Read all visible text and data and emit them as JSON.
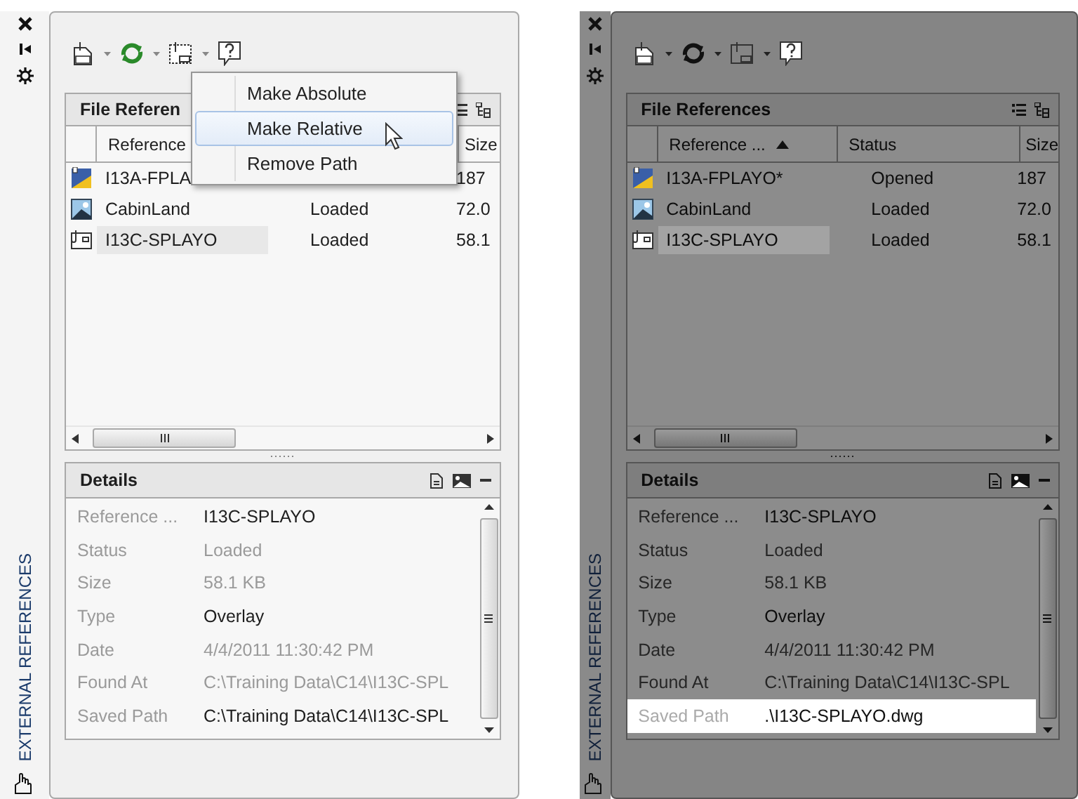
{
  "panels": [
    {
      "dimmed": false,
      "side_title": "EXTERNAL REFERENCES",
      "file_references": {
        "title": "File Referen",
        "columns": [
          {
            "kind": "name",
            "label": "Reference"
          },
          {
            "kind": "size",
            "label": "Size"
          }
        ],
        "rows": [
          {
            "kind": "dwg_open",
            "name": "I13A-FPLA",
            "size": "187",
            "selected": false
          },
          {
            "kind": "raster",
            "name": "CabinLand",
            "status": "Loaded",
            "size": "72.0",
            "selected": false
          },
          {
            "kind": "dwg",
            "name": "I13C-SPLAYO",
            "status": "Loaded",
            "size": "58.1",
            "selected": true
          }
        ]
      },
      "menu": {
        "items": [
          {
            "label": "Make Absolute",
            "selected": false
          },
          {
            "label": "Make Relative",
            "selected": true
          },
          {
            "label": "Remove Path",
            "selected": false
          }
        ]
      },
      "details": {
        "title": "Details",
        "rows": [
          {
            "label": "Reference ...",
            "value": "I13C-SPLAYO",
            "emphasized": true,
            "selected": false
          },
          {
            "label": "Status",
            "value": "Loaded",
            "emphasized": false,
            "selected": false
          },
          {
            "label": "Size",
            "value": "58.1 KB",
            "emphasized": false,
            "selected": false
          },
          {
            "label": "Type",
            "value": "Overlay",
            "emphasized": true,
            "selected": false
          },
          {
            "label": "Date",
            "value": "4/4/2011 11:30:42 PM",
            "emphasized": false,
            "selected": false
          },
          {
            "label": "Found At",
            "value": "C:\\Training Data\\C14\\I13C-SPL",
            "emphasized": false,
            "selected": false
          },
          {
            "label": "Saved Path",
            "value": "C:\\Training Data\\C14\\I13C-SPL",
            "emphasized": true,
            "selected": false
          }
        ]
      }
    },
    {
      "dimmed": true,
      "side_title": "EXTERNAL REFERENCES",
      "file_references": {
        "title": "File References",
        "columns": [
          {
            "kind": "name",
            "label": "Reference ...",
            "sorted": true
          },
          {
            "kind": "status",
            "label": "Status"
          },
          {
            "kind": "size",
            "label": "Size"
          }
        ],
        "rows": [
          {
            "kind": "dwg_open",
            "name": "I13A-FPLAYO*",
            "status": "Opened",
            "size": "187",
            "selected": false
          },
          {
            "kind": "raster",
            "name": "CabinLand",
            "status": "Loaded",
            "size": "72.0",
            "selected": false
          },
          {
            "kind": "dwg",
            "name": "I13C-SPLAYO",
            "status": "Loaded",
            "size": "58.1",
            "selected": true
          }
        ]
      },
      "details": {
        "title": "Details",
        "rows": [
          {
            "label": "Reference ...",
            "value": "I13C-SPLAYO",
            "emphasized": true,
            "selected": false
          },
          {
            "label": "Status",
            "value": "Loaded",
            "emphasized": false,
            "selected": false
          },
          {
            "label": "Size",
            "value": "58.1 KB",
            "emphasized": false,
            "selected": false
          },
          {
            "label": "Type",
            "value": "Overlay",
            "emphasized": true,
            "selected": false
          },
          {
            "label": "Date",
            "value": "4/4/2011 11:30:42 PM",
            "emphasized": false,
            "selected": false
          },
          {
            "label": "Found At",
            "value": "C:\\Training Data\\C14\\I13C-SPL",
            "emphasized": false,
            "selected": false
          },
          {
            "label": "Saved Path",
            "value": ".\\I13C-SPLAYO.dwg",
            "emphasized": true,
            "selected": true
          }
        ]
      }
    }
  ]
}
